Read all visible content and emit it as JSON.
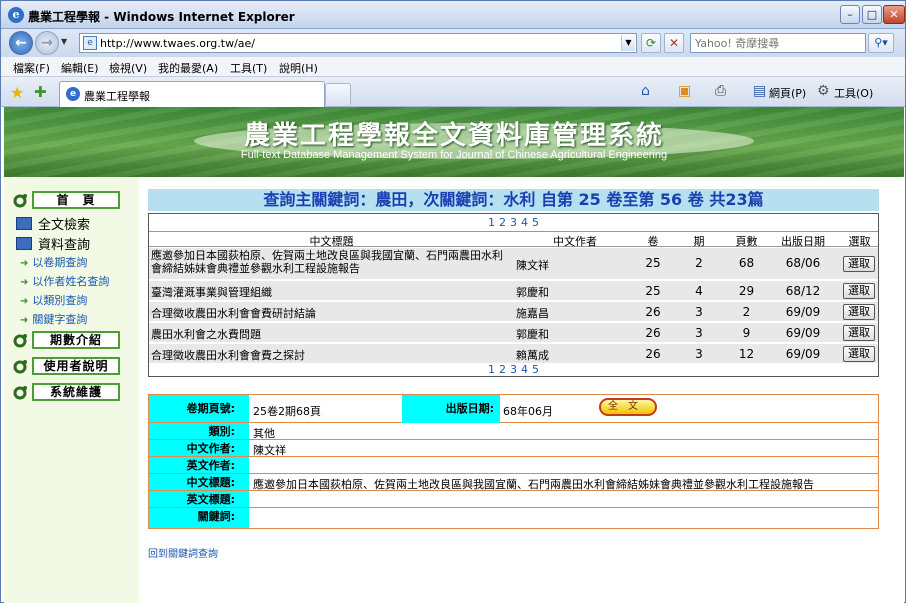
{
  "window": {
    "title": "農業工程學報 - Windows Internet Explorer",
    "ie_logo_letter": "e"
  },
  "address": {
    "url": "http://www.twaes.org.tw/ae/",
    "search_placeholder": "Yahoo! 奇摩搜尋"
  },
  "menu": [
    "檔案(F)",
    "編輯(E)",
    "檢視(V)",
    "我的最愛(A)",
    "工具(T)",
    "說明(H)"
  ],
  "tab": {
    "label": "農業工程學報"
  },
  "commandbar": {
    "page_label": "網頁(P)",
    "tools_label": "工具(O)"
  },
  "banner": {
    "title_cn": "農業工程學報全文資料庫管理系統",
    "title_en": "Full-text Database Management System for Journal of Chinese Agricultural Engineering"
  },
  "sidebar": {
    "home": "首　頁",
    "fulltext_search": "全文檢索",
    "data_query": "資料查詢",
    "links": [
      "以卷期查詢",
      "以作者姓名查詢",
      "以類別查詢",
      "關鍵字查詢"
    ],
    "issue_intro": "期數介紹",
    "user_guide": "使用者說明",
    "maintenance": "系統維護"
  },
  "query": {
    "heading": "查詢主關鍵詞：農田，次關鍵詞：水利 自第 25 卷至第 56 卷 共23篇",
    "pages": [
      "1",
      "2",
      "3",
      "4",
      "5"
    ],
    "columns": [
      "中文標題",
      "中文作者",
      "卷",
      "期",
      "頁數",
      "出版日期",
      "選取"
    ],
    "select_label": "選取",
    "rows": [
      {
        "title": "應邀參加日本國荻柏原、佐賀兩土地改良區與我國宜蘭、石門兩農田水利會締結姊妹會典禮並參觀水利工程設施報告",
        "author": "陳文祥",
        "vol": "25",
        "issue": "2",
        "page": "68",
        "date": "68/06"
      },
      {
        "title": "臺灣灌溉事業與管理組織",
        "author": "郭慶和",
        "vol": "25",
        "issue": "4",
        "page": "29",
        "date": "68/12"
      },
      {
        "title": "合理徵收農田水利會會費研討結論",
        "author": "施嘉昌",
        "vol": "26",
        "issue": "3",
        "page": "2",
        "date": "69/09"
      },
      {
        "title": "農田水利會之水費問題",
        "author": "郭慶和",
        "vol": "26",
        "issue": "3",
        "page": "9",
        "date": "69/09"
      },
      {
        "title": "合理徵收農田水利會會費之探討",
        "author": "賴萬成",
        "vol": "26",
        "issue": "3",
        "page": "12",
        "date": "69/09"
      }
    ]
  },
  "detail": {
    "vol_label": "卷期頁號:",
    "vol_value": "25卷2期68頁",
    "date_label": "出版日期:",
    "date_value": "68年06月",
    "fulltext_button": "全文",
    "category_label": "類別:",
    "category_value": "其他",
    "cn_author_label": "中文作者:",
    "cn_author_value": "陳文祥",
    "en_author_label": "英文作者:",
    "en_author_value": "",
    "cn_title_label": "中文標題:",
    "cn_title_value": "應邀參加日本國荻柏原、佐賀兩土地改良區與我國宜蘭、石門兩農田水利會締結姊妹會典禮並參觀水利工程設施報告",
    "en_title_label": "英文標題:",
    "en_title_value": "",
    "keyword_label": "關鍵詞:",
    "keyword_value": ""
  },
  "back_link": "回到關鍵詞查詢",
  "colors": {
    "accent_cyan": "#00ffff",
    "heading_blue": "#1a3fb0",
    "banner_green": "#4f9a3f"
  }
}
